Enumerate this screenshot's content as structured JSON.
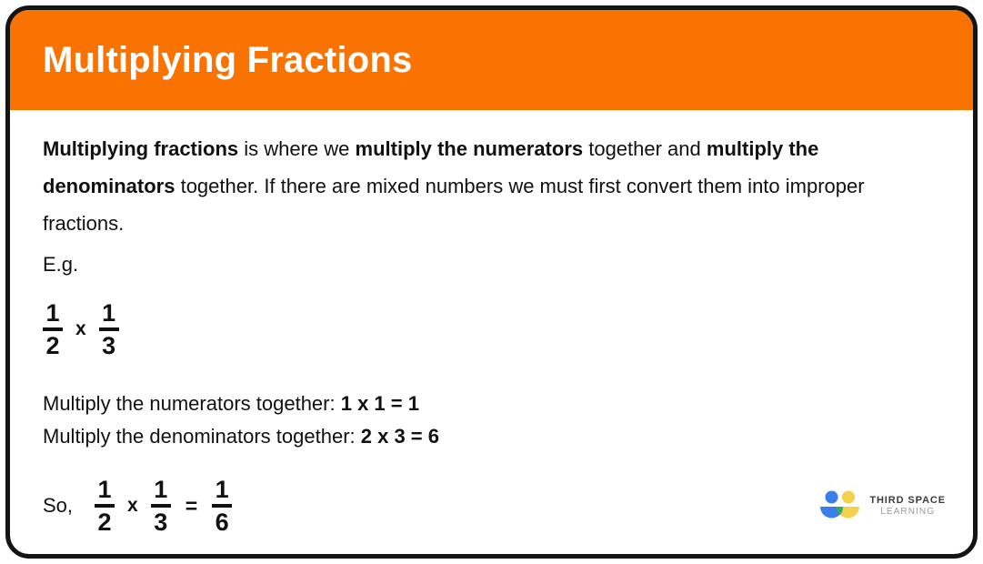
{
  "card": {
    "border_color": "#141414",
    "background": "#ffffff"
  },
  "header": {
    "title": "Multiplying Fractions",
    "background": "#fa7300",
    "text_color": "#ffffff"
  },
  "body": {
    "intro": {
      "part1_bold": "Multiplying fractions",
      "part2": " is where we ",
      "part3_bold": "multiply the numerators",
      "part4": " together and ",
      "part5_bold": "multiply the denominators",
      "part6": " together. If there are mixed numbers we must first convert them into improper fractions."
    },
    "eg_label": "E.g.",
    "example_equation": {
      "fraction_a": {
        "numerator": "1",
        "denominator": "2"
      },
      "operator": "x",
      "fraction_b": {
        "numerator": "1",
        "denominator": "3"
      }
    },
    "steps": [
      {
        "label": "Multiply the numerators together: ",
        "result": "1 x 1 = 1"
      },
      {
        "label": "Multiply the denominators together: ",
        "result": "2 x 3 = 6"
      }
    ],
    "final": {
      "so_label": "So,",
      "fraction_a": {
        "numerator": "1",
        "denominator": "2"
      },
      "operator_multiply": "x",
      "fraction_b": {
        "numerator": "1",
        "denominator": "3"
      },
      "operator_equals": "=",
      "fraction_result": {
        "numerator": "1",
        "denominator": "6"
      }
    }
  },
  "logo": {
    "line1": "THIRD SPACE",
    "line2": "LEARNING",
    "colors": {
      "blue": "#3b7dea",
      "yellow": "#f2d24b",
      "green": "#35a86a"
    }
  }
}
